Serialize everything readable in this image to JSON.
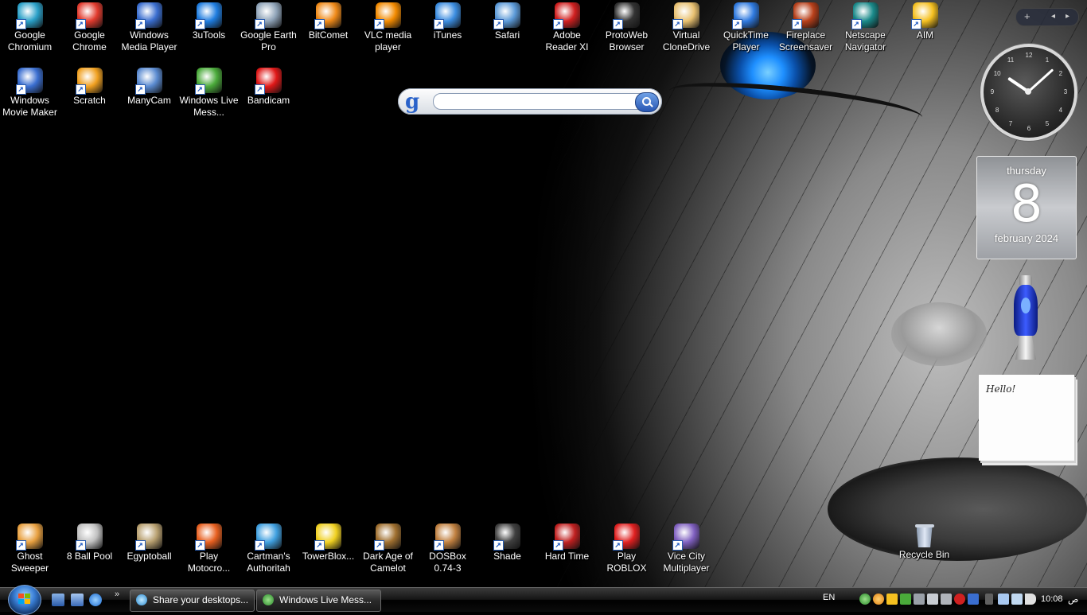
{
  "desktop": {
    "top_row": [
      {
        "label": "Google Chromium",
        "icon": "chromium-icon",
        "color": "#2aa0c8"
      },
      {
        "label": "Google Chrome",
        "icon": "chrome-icon",
        "color": "#e23b2e"
      },
      {
        "label": "Windows Media Player",
        "icon": "media-player-icon",
        "color": "#3a6ed0"
      },
      {
        "label": "3uTools",
        "icon": "3utools-icon",
        "color": "#1f7de0"
      },
      {
        "label": "Google Earth Pro",
        "icon": "google-earth-icon",
        "color": "#8fa3b8"
      },
      {
        "label": "BitComet",
        "icon": "bitcomet-icon",
        "color": "#f08a18"
      },
      {
        "label": "VLC media player",
        "icon": "vlc-icon",
        "color": "#f28a00"
      },
      {
        "label": "iTunes",
        "icon": "itunes-icon",
        "color": "#3c8de0"
      },
      {
        "label": "Safari",
        "icon": "safari-icon",
        "color": "#5c9ad8"
      },
      {
        "label": "Adobe Reader XI",
        "icon": "adobe-reader-icon",
        "color": "#d01f1f"
      },
      {
        "label": "ProtoWeb Browser",
        "icon": "protoweb-icon",
        "color": "#333333"
      },
      {
        "label": "Virtual CloneDrive",
        "icon": "clonedrive-icon",
        "color": "#e8c070"
      },
      {
        "label": "QuickTime Player",
        "icon": "quicktime-icon",
        "color": "#2f7ae0"
      },
      {
        "label": "Fireplace Screensaver",
        "icon": "fireplace-icon",
        "color": "#b8401a"
      },
      {
        "label": "Netscape Navigator",
        "icon": "netscape-icon",
        "color": "#1a8a8a"
      },
      {
        "label": "AIM",
        "icon": "aim-icon",
        "color": "#f5c020"
      }
    ],
    "second_row": [
      {
        "label": "Windows Movie Maker",
        "icon": "movie-maker-icon",
        "color": "#3a6ed0"
      },
      {
        "label": "Scratch",
        "icon": "scratch-icon",
        "color": "#f0a020"
      },
      {
        "label": "ManyCam",
        "icon": "manycam-icon",
        "color": "#5a8ad0"
      },
      {
        "label": "Windows Live Mess...",
        "icon": "live-messenger-icon",
        "color": "#4aaa3a"
      },
      {
        "label": "Bandicam",
        "icon": "bandicam-icon",
        "color": "#e01818"
      }
    ],
    "bottom_row": [
      {
        "label": "Ghost Sweeper",
        "icon": "ghost-sweeper-icon",
        "color": "#e8a040"
      },
      {
        "label": "8 Ball Pool",
        "icon": "8-ball-pool-icon",
        "color": "#c0c0c0"
      },
      {
        "label": "Egyptoball",
        "icon": "egyptoball-icon",
        "color": "#b8a070"
      },
      {
        "label": "Play Motocro...",
        "icon": "motocross-icon",
        "color": "#e86020"
      },
      {
        "label": "Cartman's Authoritah",
        "icon": "cartman-icon",
        "color": "#40a0e0"
      },
      {
        "label": "TowerBlox...",
        "icon": "towerblox-icon",
        "color": "#f0d020"
      },
      {
        "label": "Dark Age of Camelot",
        "icon": "camelot-icon",
        "color": "#a07030"
      },
      {
        "label": "DOSBox 0.74-3",
        "icon": "dosbox-icon",
        "color": "#c08040"
      },
      {
        "label": "Shade",
        "icon": "shade-icon",
        "color": "#404040"
      },
      {
        "label": "Hard Time",
        "icon": "hard-time-icon",
        "color": "#c02020"
      },
      {
        "label": "Play ROBLOX",
        "icon": "roblox-icon",
        "color": "#e02020"
      },
      {
        "label": "Vice City Multiplayer",
        "icon": "vice-city-icon",
        "color": "#8060c0"
      }
    ],
    "recycle_bin": {
      "label": "Recycle Bin",
      "icon": "recycle-bin-icon"
    }
  },
  "google_gadget": {
    "logo": "g",
    "placeholder": ""
  },
  "sidebar": {
    "add": "+",
    "prev": "◂",
    "next": "▸",
    "clock": {
      "numbers": [
        "12",
        "1",
        "2",
        "3",
        "4",
        "5",
        "6",
        "7",
        "8",
        "9",
        "10",
        "11"
      ],
      "hour": 10,
      "minute": 8
    },
    "calendar": {
      "day": "thursday",
      "date": "8",
      "month": "february 2024"
    },
    "note": {
      "text": "Hello!"
    }
  },
  "taskbar": {
    "chevron": "»",
    "tasks": [
      {
        "label": "Share your desktops...",
        "icon": "browser-task-icon"
      },
      {
        "label": "Windows Live Mess...",
        "icon": "live-messenger-task-icon"
      }
    ],
    "language": "EN",
    "time": "10:08",
    "period": "ص"
  }
}
